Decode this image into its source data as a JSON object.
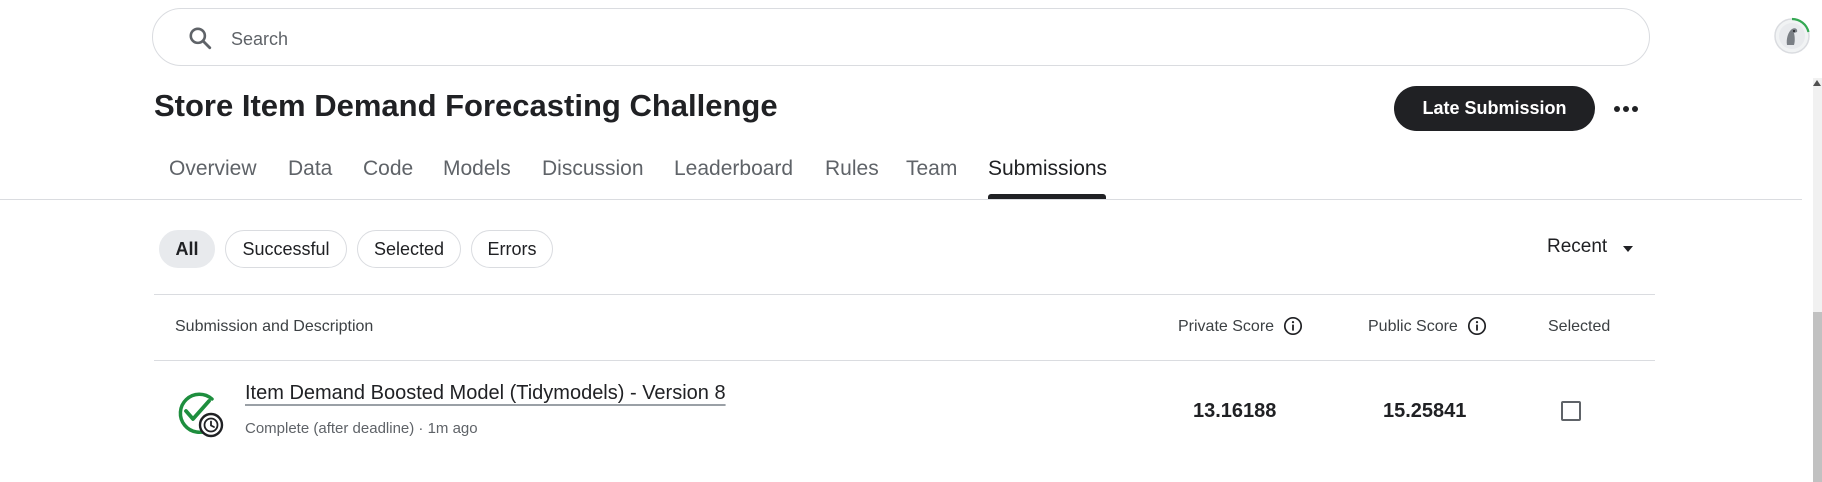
{
  "search": {
    "placeholder": "Search"
  },
  "competition": {
    "title": "Store Item Demand Forecasting Challenge",
    "late_submission_label": "Late Submission"
  },
  "tabs": [
    {
      "label": "Overview"
    },
    {
      "label": "Data"
    },
    {
      "label": "Code"
    },
    {
      "label": "Models"
    },
    {
      "label": "Discussion"
    },
    {
      "label": "Leaderboard"
    },
    {
      "label": "Rules"
    },
    {
      "label": "Team"
    },
    {
      "label": "Submissions",
      "active": true
    }
  ],
  "filters": {
    "chips": [
      {
        "label": "All",
        "active": true
      },
      {
        "label": "Successful"
      },
      {
        "label": "Selected"
      },
      {
        "label": "Errors"
      }
    ],
    "sort_label": "Recent"
  },
  "table": {
    "headers": {
      "submission": "Submission and Description",
      "private_score": "Private Score",
      "public_score": "Public Score",
      "selected": "Selected"
    },
    "rows": [
      {
        "title": "Item Demand Boosted Model (Tidymodels) - Version 8",
        "meta": "Complete (after deadline) · 1m ago",
        "private_score": "13.16188",
        "public_score": "15.25841",
        "selected": false
      }
    ]
  },
  "icons": {
    "search": "search-icon",
    "more": "more-horizontal-icon",
    "info": "info-icon",
    "status": "check-with-clock-icon",
    "sort": "caret-down-icon"
  },
  "colors": {
    "primary_button_bg": "#202124",
    "status_green": "#1e8e3e",
    "avatar_ring": "#34a853"
  }
}
